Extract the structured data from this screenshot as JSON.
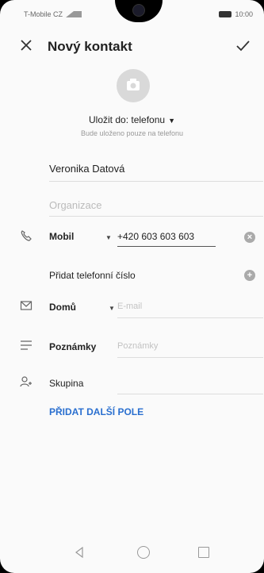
{
  "status": {
    "carrier": "T-Mobile CZ",
    "time": "10:00"
  },
  "header": {
    "title": "Nový kontakt"
  },
  "save_to": {
    "label": "Uložit do: telefonu",
    "note": "Bude uloženo pouze na telefonu"
  },
  "fields": {
    "name": "Veronika Datová",
    "organization_placeholder": "Organizace",
    "phone_type": "Mobil",
    "phone_value": "+420 603 603 603",
    "add_phone": "Přidat telefonní číslo",
    "email_type": "Domů",
    "email_placeholder": "E-mail",
    "notes_label": "Poznámky",
    "notes_placeholder": "Poznámky",
    "group_label": "Skupina"
  },
  "more_fields": "PŘIDAT DALŠÍ POLE",
  "icons": [
    "close-icon",
    "check-icon",
    "camera-icon",
    "phone-icon",
    "mail-icon",
    "notes-icon",
    "group-icon",
    "clear-icon",
    "add-icon"
  ]
}
